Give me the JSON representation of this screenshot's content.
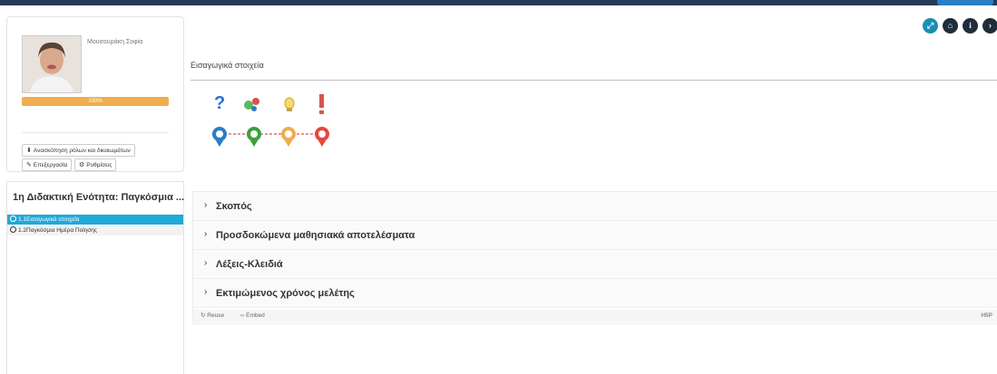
{
  "profile": {
    "name": "Μουσουράκη Σοφία",
    "progress_label": "100%",
    "progress_fraction": 1.0,
    "roles_button": "Ανασκόπηση ρόλων και δικαιωμάτων",
    "edit_button": "Επεξεργασία",
    "settings_button": "Ρυθμίσεις"
  },
  "lesson": {
    "title": "1η Διδακτική Ενότητα: Παγκόσμια ...",
    "items": [
      {
        "label": "1.1Εισαγωγικά στοιχεία",
        "active": true
      },
      {
        "label": "1.2Παγκόσμια Ημέρα Ποίησης",
        "active": false
      }
    ]
  },
  "top_icons": [
    "fullscreen-icon",
    "home-icon",
    "info-icon",
    "next-icon"
  ],
  "main": {
    "title": "Εισαγωγικά στοιχεία",
    "accordion": [
      {
        "label": "Σκοπός"
      },
      {
        "label": "Προσδοκώμενα μαθησιακά αποτελέσματα"
      },
      {
        "label": "Λέξεις-Κλειδιά"
      },
      {
        "label": "Εκτιμώμενος χρόνος μελέτης"
      }
    ],
    "footer": {
      "reuse": "Reuse",
      "embed": "Embed",
      "brand": "H5P"
    }
  },
  "colors": {
    "accent": "#21a9d8",
    "progress": "#f0ad4e",
    "icon_dark": "#1f2d3d",
    "icon_teal": "#1a8fb0"
  }
}
